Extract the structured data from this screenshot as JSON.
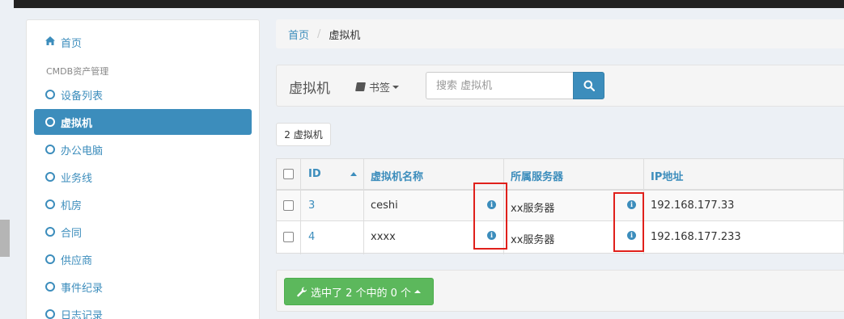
{
  "sidebar": {
    "home_label": "首页",
    "section_header": "CMDB资产管理",
    "items": [
      {
        "label": "设备列表",
        "active": false
      },
      {
        "label": "虚拟机",
        "active": true
      },
      {
        "label": "办公电脑",
        "active": false
      },
      {
        "label": "业务线",
        "active": false
      },
      {
        "label": "机房",
        "active": false
      },
      {
        "label": "合同",
        "active": false
      },
      {
        "label": "供应商",
        "active": false
      },
      {
        "label": "事件纪录",
        "active": false
      },
      {
        "label": "日志记录",
        "active": false
      }
    ]
  },
  "breadcrumb": {
    "home": "首页",
    "separator": "/",
    "current": "虚拟机"
  },
  "header": {
    "title": "虚拟机",
    "bookmark_label": "书签",
    "search_placeholder": "搜索 虚拟机"
  },
  "count_badge": "2 虚拟机",
  "table": {
    "columns": [
      "ID",
      "虚拟机名称",
      "所属服务器",
      "IP地址"
    ],
    "rows": [
      {
        "id": "3",
        "name": "ceshi",
        "server": "xx服务器",
        "ip": "192.168.177.33"
      },
      {
        "id": "4",
        "name": "xxxx",
        "server": "xx服务器",
        "ip": "192.168.177.233"
      }
    ]
  },
  "bulk_action_label": "选中了 2 个中的 0 个",
  "icons": {
    "home": "home-icon",
    "bookmark": "book-icon",
    "search": "search-icon",
    "info": "info-icon",
    "wrench": "wrench-icon"
  },
  "colors": {
    "primary": "#3c8dbc",
    "success": "#5cb85c",
    "highlight": "#e0201b"
  }
}
